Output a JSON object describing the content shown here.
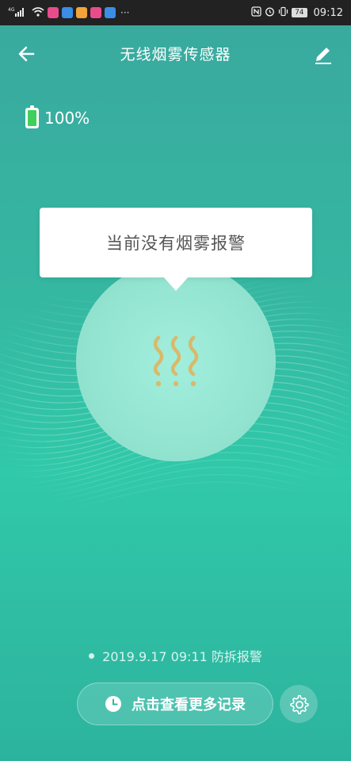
{
  "status_bar": {
    "network": "4G",
    "dots": "···",
    "battery": "74",
    "time": "09:12"
  },
  "header": {
    "title": "无线烟雾传感器",
    "back_icon": "arrow-left-icon",
    "edit_icon": "pencil-icon"
  },
  "battery": {
    "level_text": "100%",
    "level": 1.0,
    "color": "#3fcf5a"
  },
  "status": {
    "message": "当前没有烟雾报警",
    "icon": "smoke-icon",
    "icon_color": "#d9b96a"
  },
  "last_record": {
    "text": "2019.9.17 09:11 防拆报警"
  },
  "actions": {
    "more_records_label": "点击查看更多记录",
    "clock_icon": "clock-icon",
    "settings_icon": "gear-icon"
  }
}
